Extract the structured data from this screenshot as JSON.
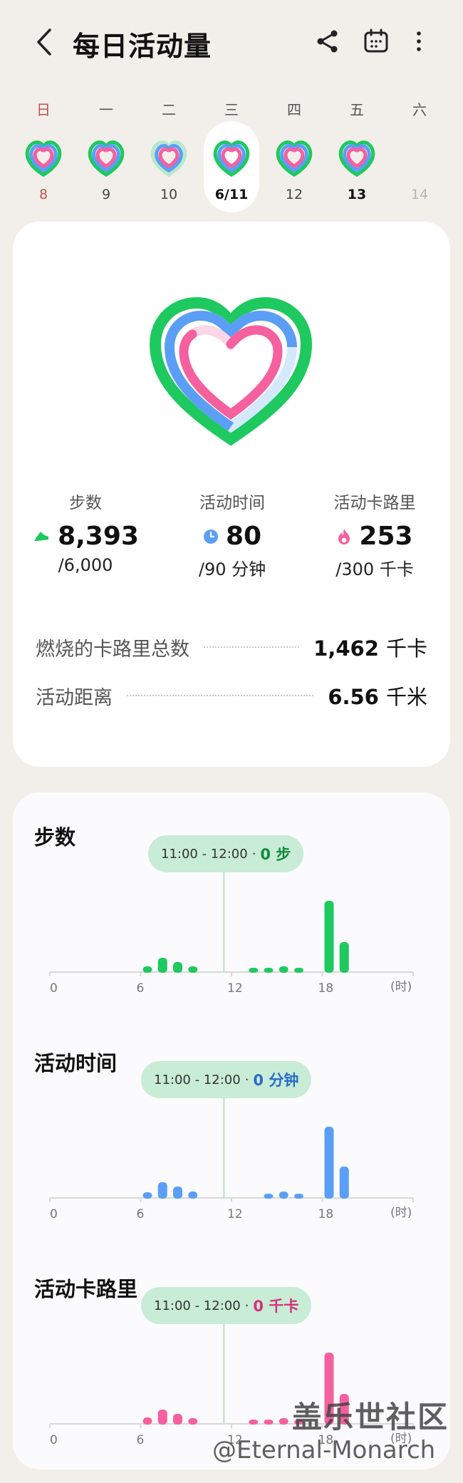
{
  "header": {
    "title": "每日活动量",
    "back_icon": "chevron-left-icon",
    "share_icon": "share-icon",
    "calendar_icon": "calendar-icon",
    "more_icon": "more-vertical-icon"
  },
  "week": {
    "days": [
      {
        "name": "日",
        "num": "8"
      },
      {
        "name": "一",
        "num": "9"
      },
      {
        "name": "二",
        "num": "10"
      },
      {
        "name": "三",
        "num": "6/11"
      },
      {
        "name": "四",
        "num": "12"
      },
      {
        "name": "五",
        "num": "13"
      },
      {
        "name": "六",
        "num": "14"
      }
    ],
    "selected_index": 3
  },
  "summary": {
    "steps": {
      "label": "步数",
      "value": "8,393",
      "goal": "/6,000"
    },
    "active_time": {
      "label": "活动时间",
      "value": "80",
      "goal": "/90 分钟"
    },
    "active_cal": {
      "label": "活动卡路里",
      "value": "253",
      "goal": "/300 千卡"
    },
    "total_cal": {
      "label": "燃烧的卡路里总数",
      "value": "1,462",
      "unit": "千卡"
    },
    "distance": {
      "label": "活动距离",
      "value": "6.56",
      "unit": "千米"
    }
  },
  "colors": {
    "green": "#1ec95f",
    "blue": "#5b9ef5",
    "pink": "#f5609e",
    "pill_bg": "#c8ecd6",
    "sunday": "#c0504d"
  },
  "charts": {
    "x_ticks": [
      "0",
      "6",
      "12",
      "18"
    ],
    "x_unit": "(时)",
    "tooltip_range": "11:00 - 12:00",
    "tooltip_sep": "·",
    "steps": {
      "title": "步数",
      "tooltip_value": "0 步"
    },
    "time": {
      "title": "活动时间",
      "tooltip_value": "0 分钟"
    },
    "cal": {
      "title": "活动卡路里",
      "tooltip_value": "0 千卡"
    }
  },
  "chart_data": [
    {
      "type": "bar",
      "title": "步数",
      "x": [
        6,
        7,
        8,
        9,
        13,
        14,
        15,
        16,
        18,
        19
      ],
      "values": [
        0.08,
        0.2,
        0.14,
        0.08,
        0.05,
        0.05,
        0.08,
        0.05,
        1.0,
        0.42
      ],
      "xlabel": "(时)",
      "xlim": [
        0,
        24
      ],
      "color": "#1ec95f"
    },
    {
      "type": "bar",
      "title": "活动时间",
      "x": [
        6,
        7,
        8,
        9,
        14,
        15,
        16,
        18,
        19
      ],
      "values": [
        0.08,
        0.22,
        0.16,
        0.09,
        0.06,
        0.09,
        0.06,
        1.0,
        0.44
      ],
      "xlabel": "(时)",
      "xlim": [
        0,
        24
      ],
      "color": "#5b9ef5"
    },
    {
      "type": "bar",
      "title": "活动卡路里",
      "x": [
        6,
        7,
        8,
        9,
        13,
        14,
        15,
        16,
        18,
        19
      ],
      "values": [
        0.09,
        0.2,
        0.14,
        0.08,
        0.06,
        0.06,
        0.08,
        0.06,
        1.0,
        0.42
      ],
      "xlabel": "(时)",
      "xlim": [
        0,
        24
      ],
      "color": "#f5609e"
    }
  ],
  "watermark": {
    "line1": "盖乐世社区",
    "line2": "@Eternal-Monarch"
  }
}
